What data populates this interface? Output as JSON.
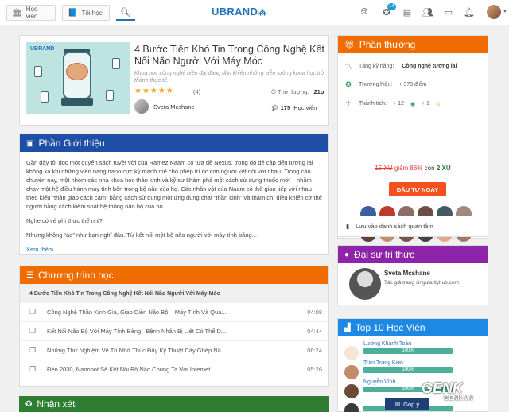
{
  "nav": {
    "tab_vien": "Học viên",
    "tab_toi": "Tôi học",
    "logo": "UBRAND",
    "badge": "14"
  },
  "course": {
    "title": "4 Bước Tiến Khó Tin Trong Công Nghệ Kết Nối Não Người Với Máy Móc",
    "subtitle": "Khoa học công nghệ hiện đại đang dần khiến những viễn tưởng khoa học trở thành thực tế.",
    "stars": "★★★★★",
    "rating": 4.5,
    "rating_count": "(4)",
    "time_label": "Thời lượng:",
    "time_value": "21p",
    "instructor": "Sveta Mcshane",
    "students_count": "175",
    "students_label": "Học viên"
  },
  "intro": {
    "title": "Phần Giới thiệu",
    "p1": "Gần đây tôi đọc một quyển sách tuyệt vời của Ramez Naam có tựa đề Nexus, trong đó đề cập đến tương lai không xa khi những viên nang nano cực kỳ mạnh mẽ cho phép trí óc con người kết nối với nhau. Trong câu chuyện này, một nhóm các nhà khoa học thần kinh và kỹ sư khám phá một cách sử dụng thuốc mới – nhằm chạy một hệ điều hành máy tính bên trong bộ não của họ. Các nhân vật của Naam có thể giao tiếp với nhau theo kiểu “thần giao cách cảm” bằng cách sử dụng một ứng dụng chat “thần kinh” và thậm chí điều khiển cơ thể người bằng cách kiểm soát hệ thống não bộ của họ.",
    "p2": "Nghe có vẻ phi thực thế nhỉ?",
    "p3": "Nhưng không “ảo” như bạn nghĩ đâu. Từ kết nối một bộ não người với máy tính bằng...",
    "more": "Xem thêm"
  },
  "curriculum": {
    "title": "Chương trình học",
    "course_name": "4 Bước Tiến Khó Tin Trong Công Nghệ Kết Nối Não Người Với Máy Móc",
    "lessons": [
      {
        "name": "Công Nghệ Thần Kinh Giả, Giao Diện Não Bộ – Máy Tính Và Qua...",
        "duration": "04:08"
      },
      {
        "name": "Kết Nối Não Bộ Với Máy Tính Bảng– Bệnh Nhân Bị Liệt Có Thể D...",
        "duration": "04:44"
      },
      {
        "name": "Những Thử Nghiệm Về Trí Nhớ Thúc Đẩy Kỹ Thuật Cấy Ghép Nã...",
        "duration": "06:24"
      },
      {
        "name": "Đến 2030, Nanobot Sẽ Kết Nối Bộ Não Chúng Ta Với Internet",
        "duration": "05:26"
      }
    ]
  },
  "reviews": {
    "title": "Nhận xét"
  },
  "rewards": {
    "title": "Phần thưởng",
    "skill_label": "Tăng kỹ năng:",
    "skill_value": "Công nghệ tương lai",
    "brand_label": "Thương hiệu:",
    "brand_value": "+ 378 điểm",
    "achv_label": "Thành tích:",
    "achv_a": "+ 12",
    "achv_b": "+ 1",
    "price_old": "15 XU",
    "price_disc": "giảm 86%",
    "price_mid": "còn",
    "price_new": "2 XU",
    "buy_label": "ĐẦU TƯ NGAY",
    "watch_label": "Lưu vào danh sách quan tâm",
    "user_colors": [
      "#3a5fa0",
      "#c0392b",
      "#8d6e63",
      "#6d4c41",
      "#455a64",
      "#a1887f",
      "#5d4037",
      "#c58b6b",
      "#795548",
      "#424242",
      "#e0a98f",
      "#9e7a62"
    ]
  },
  "author": {
    "title": "Đại sư tri thức",
    "name": "Sveta Mcshane",
    "desc": "Tác giả trang singularityhub.com"
  },
  "top10": {
    "title": "Top 10 Học Viên",
    "students": [
      {
        "name": "Lương Khánh Toàn",
        "pct": "100%",
        "color": "#f4e7d7"
      },
      {
        "name": "Trần Trung Kiên",
        "pct": "100%",
        "color": "#c28b6a"
      },
      {
        "name": "Nguyễn Vĩnh...",
        "pct": "100%",
        "color": "#6b4a3a"
      },
      {
        "name": "...",
        "pct": "100%",
        "color": "#3a3a3a"
      }
    ]
  },
  "feedback": {
    "label": "Góp ý"
  },
  "watermark": {
    "brand": "GENK",
    "site": "GENK.VN"
  },
  "colors": {
    "primary": "#1e73be",
    "orange": "#ef6c00",
    "blue_dark": "#1f4ea6",
    "purple": "#8e24aa",
    "green": "#2e7d32"
  }
}
